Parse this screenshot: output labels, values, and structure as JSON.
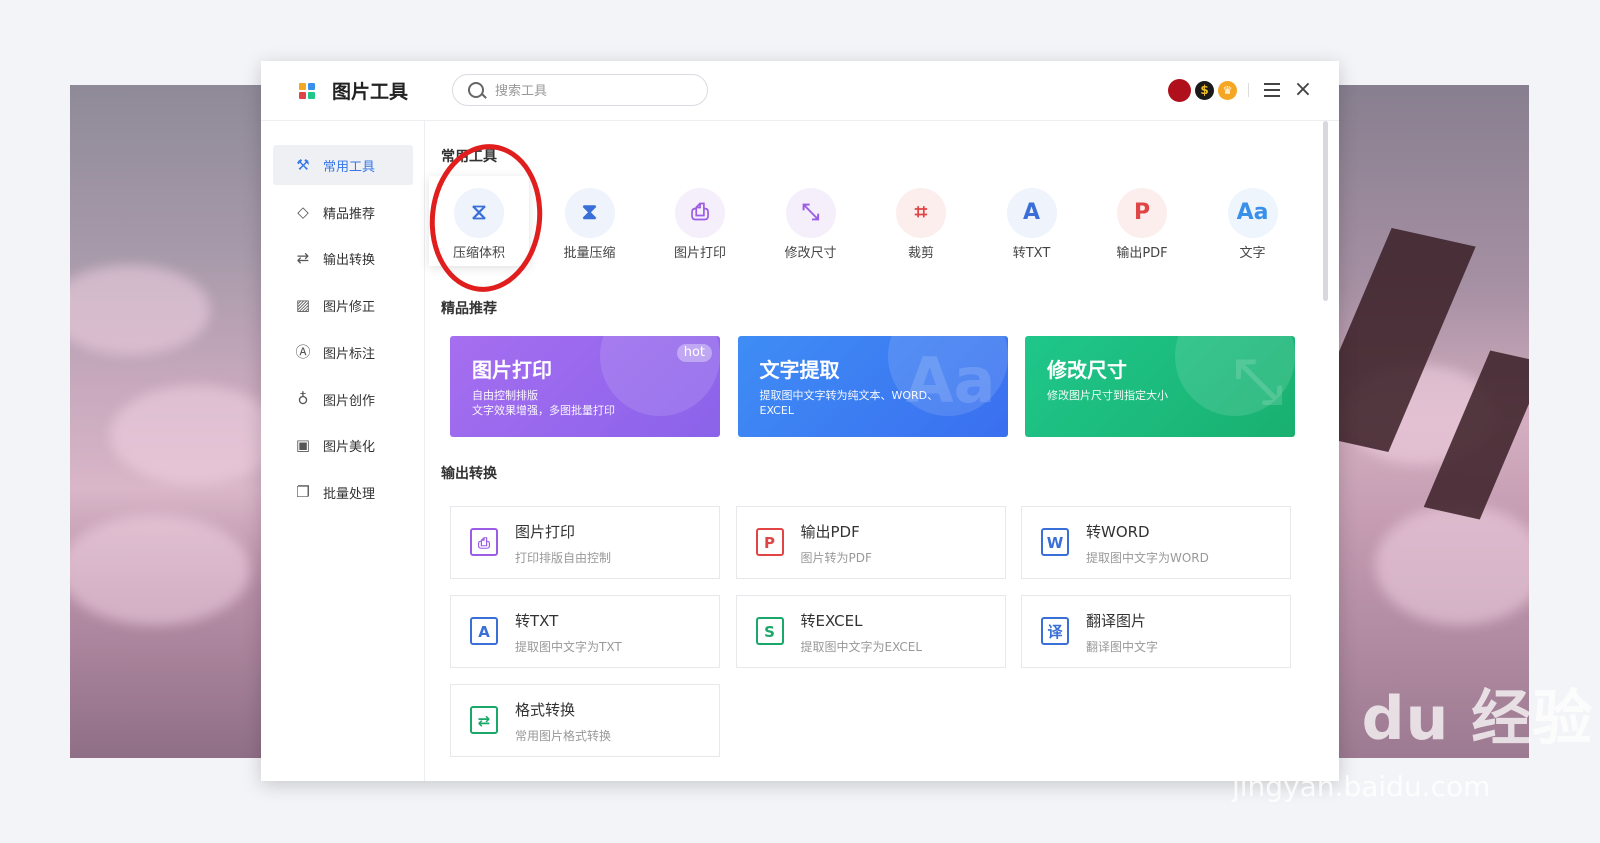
{
  "window": {
    "title": "图片工具",
    "search_placeholder": "搜索工具",
    "badge_coin": "$",
    "close_glyph": "×"
  },
  "sidebar": {
    "items": [
      {
        "label": "常用工具",
        "icon": "wrench-icon",
        "glyph": "⚒"
      },
      {
        "label": "精品推荐",
        "icon": "diamond-icon",
        "glyph": "◇"
      },
      {
        "label": "输出转换",
        "icon": "export-icon",
        "glyph": "⇄"
      },
      {
        "label": "图片修正",
        "icon": "image-edit-icon",
        "glyph": "▨"
      },
      {
        "label": "图片标注",
        "icon": "annotate-icon",
        "glyph": "Ⓐ"
      },
      {
        "label": "图片创作",
        "icon": "lightbulb-icon",
        "glyph": "♁"
      },
      {
        "label": "图片美化",
        "icon": "image-icon",
        "glyph": "▣"
      },
      {
        "label": "批量处理",
        "icon": "batch-icon",
        "glyph": "❐"
      }
    ]
  },
  "sections": {
    "common": "常用工具",
    "featured": "精品推荐",
    "convert": "输出转换"
  },
  "tools": [
    {
      "label": "压缩体积",
      "icon": "compress-icon",
      "glyph": "⧖",
      "color": "#3a6fd8",
      "bg": "#eef3fc"
    },
    {
      "label": "批量压缩",
      "icon": "batch-compress-icon",
      "glyph": "⧗",
      "color": "#3a6fd8",
      "bg": "#eef3fc"
    },
    {
      "label": "图片打印",
      "icon": "print-icon",
      "glyph": "⎙",
      "color": "#9b5de5",
      "bg": "#f5effc"
    },
    {
      "label": "修改尺寸",
      "icon": "resize-icon",
      "glyph": "⤡",
      "color": "#9b5de5",
      "bg": "#f5effc"
    },
    {
      "label": "裁剪",
      "icon": "crop-icon",
      "glyph": "⌗",
      "color": "#e04545",
      "bg": "#fdeeee"
    },
    {
      "label": "转TXT",
      "icon": "txt-icon",
      "glyph": "A",
      "color": "#3a6fd8",
      "bg": "#eef3fc"
    },
    {
      "label": "输出PDF",
      "icon": "pdf-icon",
      "glyph": "P",
      "color": "#e04545",
      "bg": "#fdeeee"
    },
    {
      "label": "文字",
      "icon": "text-icon",
      "glyph": "Aa",
      "color": "#3a8fe8",
      "bg": "#eef5fd"
    }
  ],
  "banners": [
    {
      "title": "图片打印",
      "sub": "自由控制排版\n文字效果增强，多图批量打印",
      "badge": "hot",
      "from": "#a66ef0",
      "to": "#8a63ea"
    },
    {
      "title": "文字提取",
      "sub": "提取图中文字转为纯文本、WORD、EXCEL",
      "big": "Aa",
      "from": "#3f8df5",
      "to": "#3a6ff0"
    },
    {
      "title": "修改尺寸",
      "sub": "修改图片尺寸到指定大小",
      "big": "⤡",
      "from": "#1fc78a",
      "to": "#19b070"
    }
  ],
  "cards": [
    {
      "title": "图片打印",
      "sub": "打印排版自由控制",
      "icon": "print-icon",
      "glyph": "⎙",
      "color": "#9b5de5"
    },
    {
      "title": "输出PDF",
      "sub": "图片转为PDF",
      "icon": "pdf-icon",
      "glyph": "P",
      "color": "#e04545"
    },
    {
      "title": "转WORD",
      "sub": "提取图中文字为WORD",
      "icon": "word-icon",
      "glyph": "W",
      "color": "#3a6fd8"
    },
    {
      "title": "转TXT",
      "sub": "提取图中文字为TXT",
      "icon": "txt-icon",
      "glyph": "A",
      "color": "#3a6fd8"
    },
    {
      "title": "转EXCEL",
      "sub": "提取图中文字为EXCEL",
      "icon": "excel-icon",
      "glyph": "S",
      "color": "#19a86a"
    },
    {
      "title": "翻译图片",
      "sub": "翻译图中文字",
      "icon": "translate-icon",
      "glyph": "译",
      "color": "#3a6fd8"
    },
    {
      "title": "格式转换",
      "sub": "常用图片格式转换",
      "icon": "format-convert-icon",
      "glyph": "⇄",
      "color": "#19a86a"
    }
  ],
  "watermark": {
    "brand": "Bai du 经验",
    "url": "jingyan.baidu.com"
  }
}
